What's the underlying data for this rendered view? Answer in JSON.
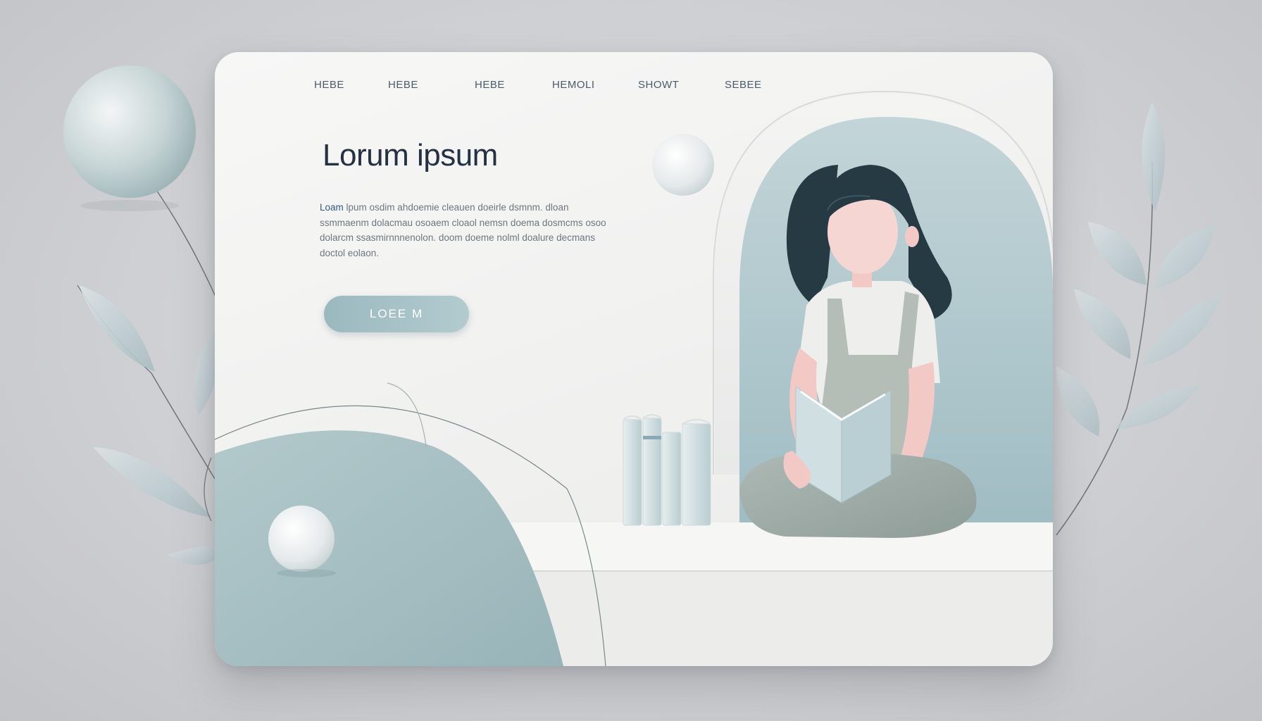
{
  "nav": {
    "items": [
      {
        "label": "HEBE"
      },
      {
        "label": "HEBE"
      },
      {
        "label": "HEBE"
      },
      {
        "label": "HEMOLI"
      },
      {
        "label": "SHOWT"
      },
      {
        "label": "SEBEE"
      }
    ]
  },
  "hero": {
    "title": "Lorum ipsum",
    "body_lead": "Loam",
    "body_text": " lpum osdim ahdoemie cleauen doeirle dsmnm. dloan ssmmaenm dolacmau osoaem cloaol nemsn doema dosmcms osoo dolarcm ssasmirnnnenolon. doom doeme nolml doalure decmans doctol eolaon.",
    "cta_label": "LOEE M"
  },
  "colors": {
    "background": "#cfd0d3",
    "card": "#f2f2f1",
    "accent_teal": "#a9c3c7",
    "title_text": "#243142",
    "nav_text": "#4c5a6a"
  },
  "icons": {
    "decor_sphere": "sphere",
    "decor_leaves": "leaf-branch",
    "reading_woman": "woman-reading-book",
    "book_stack": "books"
  }
}
